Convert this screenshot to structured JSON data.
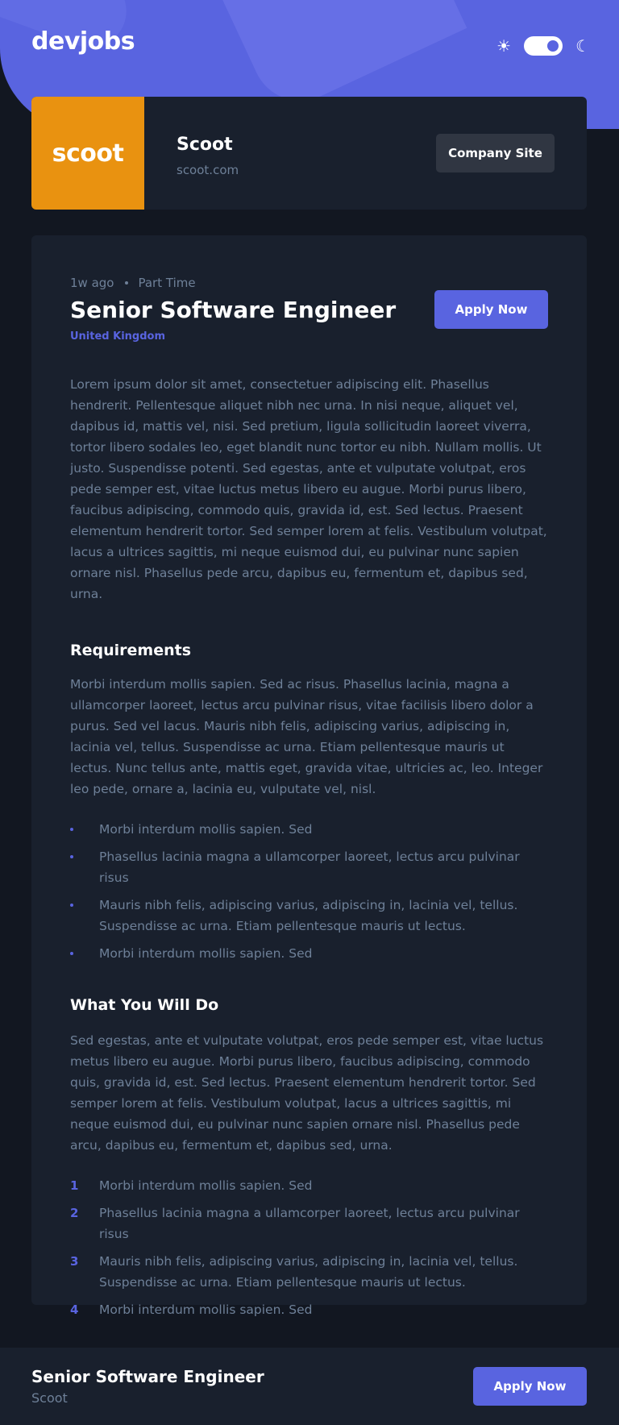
{
  "header": {
    "logo": "devjobs",
    "sun_icon": "☀",
    "moon_icon": "☾",
    "theme": "dark"
  },
  "company": {
    "logo_text": "scoot",
    "name": "Scoot",
    "website": "scoot.com",
    "site_button": "Company Site"
  },
  "job": {
    "posted": "1w ago",
    "contract": "Part Time",
    "title": "Senior Software Engineer",
    "location": "United Kingdom",
    "apply_label": "Apply Now",
    "description": "Lorem ipsum dolor sit amet, consectetuer adipiscing elit. Phasellus hendrerit. Pellentesque aliquet nibh nec urna. In nisi neque, aliquet vel, dapibus id, mattis vel, nisi. Sed pretium, ligula sollicitudin laoreet viverra, tortor libero sodales leo, eget blandit nunc tortor eu nibh. Nullam mollis. Ut justo. Suspendisse potenti. Sed egestas, ante et vulputate volutpat, eros pede semper est, vitae luctus metus libero eu augue. Morbi purus libero, faucibus adipiscing, commodo quis, gravida id, est. Sed lectus. Praesent elementum hendrerit tortor. Sed semper lorem at felis. Vestibulum volutpat, lacus a ultrices sagittis, mi neque euismod dui, eu pulvinar nunc sapien ornare nisl. Phasellus pede arcu, dapibus eu, fermentum et, dapibus sed, urna.",
    "requirements": {
      "title": "Requirements",
      "content": "Morbi interdum mollis sapien. Sed ac risus. Phasellus lacinia, magna a ullamcorper laoreet, lectus arcu pulvinar risus, vitae facilisis libero dolor a purus. Sed vel lacus. Mauris nibh felis, adipiscing varius, adipiscing in, lacinia vel, tellus. Suspendisse ac urna. Etiam pellentesque mauris ut lectus. Nunc tellus ante, mattis eget, gravida vitae, ultricies ac, leo. Integer leo pede, ornare a, lacinia eu, vulputate vel, nisl.",
      "items": [
        "Morbi interdum mollis sapien. Sed",
        "Phasellus lacinia magna a ullamcorper laoreet, lectus arcu pulvinar risus",
        "Mauris nibh felis, adipiscing varius, adipiscing in, lacinia vel, tellus. Suspendisse ac urna. Etiam pellentesque mauris ut lectus.",
        "Morbi interdum mollis sapien. Sed"
      ]
    },
    "role": {
      "title": "What You Will Do",
      "content": "Sed egestas, ante et vulputate volutpat, eros pede semper est, vitae luctus metus libero eu augue. Morbi purus libero, faucibus adipiscing, commodo quis, gravida id, est. Sed lectus. Praesent elementum hendrerit tortor. Sed semper lorem at felis. Vestibulum volutpat, lacus a ultrices sagittis, mi neque euismod dui, eu pulvinar nunc sapien ornare nisl. Phasellus pede arcu, dapibus eu, fermentum et, dapibus sed, urna.",
      "items": [
        {
          "num": "1",
          "text": "Morbi interdum mollis sapien. Sed"
        },
        {
          "num": "2",
          "text": "Phasellus lacinia magna a ullamcorper laoreet, lectus arcu pulvinar risus"
        },
        {
          "num": "3",
          "text": "Mauris nibh felis, adipiscing varius, adipiscing in, lacinia vel, tellus. Suspendisse ac urna. Etiam pellentesque mauris ut lectus."
        },
        {
          "num": "4",
          "text": "Morbi interdum mollis sapien. Sed"
        }
      ]
    }
  },
  "footer": {
    "title": "Senior Software Engineer",
    "company": "Scoot",
    "apply_label": "Apply Now"
  },
  "colors": {
    "accent": "#5964e0",
    "background": "#121721",
    "card": "#19202d",
    "company_brand": "#e99210",
    "text_muted": "#6e8098",
    "text_primary": "#ffffff"
  }
}
